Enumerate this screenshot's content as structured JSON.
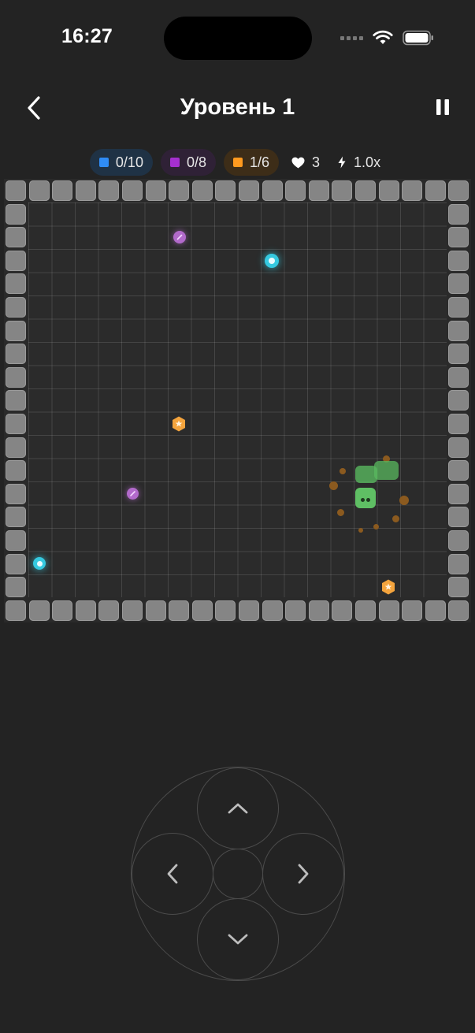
{
  "status_bar": {
    "time": "16:27"
  },
  "header": {
    "title": "Уровень 1"
  },
  "stats": {
    "blue": {
      "value": "0/10",
      "color": "#2f8cf5"
    },
    "purple": {
      "value": "0/8",
      "color": "#a52fd0"
    },
    "orange": {
      "value": "1/6",
      "color": "#ff9a1f"
    },
    "lives": {
      "value": "3"
    },
    "speed": {
      "value": "1.0x"
    }
  },
  "icons": {
    "back": "chevron-left-icon",
    "pause": "pause-icon",
    "heart": "heart-icon",
    "bolt": "bolt-icon",
    "up": "chevron-up-icon",
    "down": "chevron-down-icon",
    "left": "chevron-left-icon",
    "right": "chevron-right-icon"
  },
  "colors": {
    "background": "#232323",
    "wall": "#858585",
    "snake": "#59b85f",
    "cyan_item": "#35c9e0",
    "purple_item": "#b26acb",
    "orange_item": "#f4a43d"
  }
}
